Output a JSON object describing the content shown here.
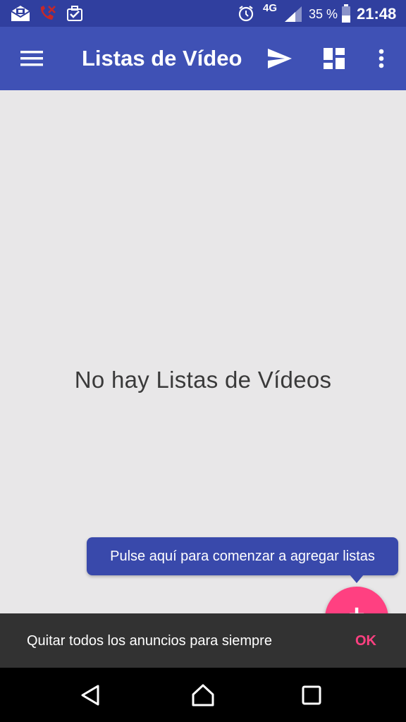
{
  "status_bar": {
    "network": "4G",
    "battery": "35 %",
    "time": "21:48",
    "icons": [
      "mail-icon",
      "missed-call-icon",
      "briefcase-check-icon",
      "alarm-icon",
      "signal-icon",
      "battery-icon"
    ]
  },
  "toolbar": {
    "title": "Listas de Vídeo",
    "icons": [
      "menu-icon",
      "send-icon",
      "dashboard-icon",
      "more-vert-icon"
    ]
  },
  "main": {
    "empty_message": "No hay Listas de Vídeos"
  },
  "tooltip": {
    "text": "Pulse aquí para comenzar a agregar listas"
  },
  "fab": {
    "icon": "add-icon",
    "glyph": "+"
  },
  "snackbar": {
    "message": "Quitar todos los anuncios para siempre",
    "action": "OK"
  },
  "nav_bar": {
    "icons": [
      "back-icon",
      "home-icon",
      "recents-icon"
    ]
  },
  "colors": {
    "status_bar": "#303f9f",
    "toolbar": "#3f51b5",
    "background": "#e8e7e8",
    "tooltip": "#3949ab",
    "accent": "#ff4081",
    "snackbar": "#323232",
    "nav_bar": "#000000"
  }
}
